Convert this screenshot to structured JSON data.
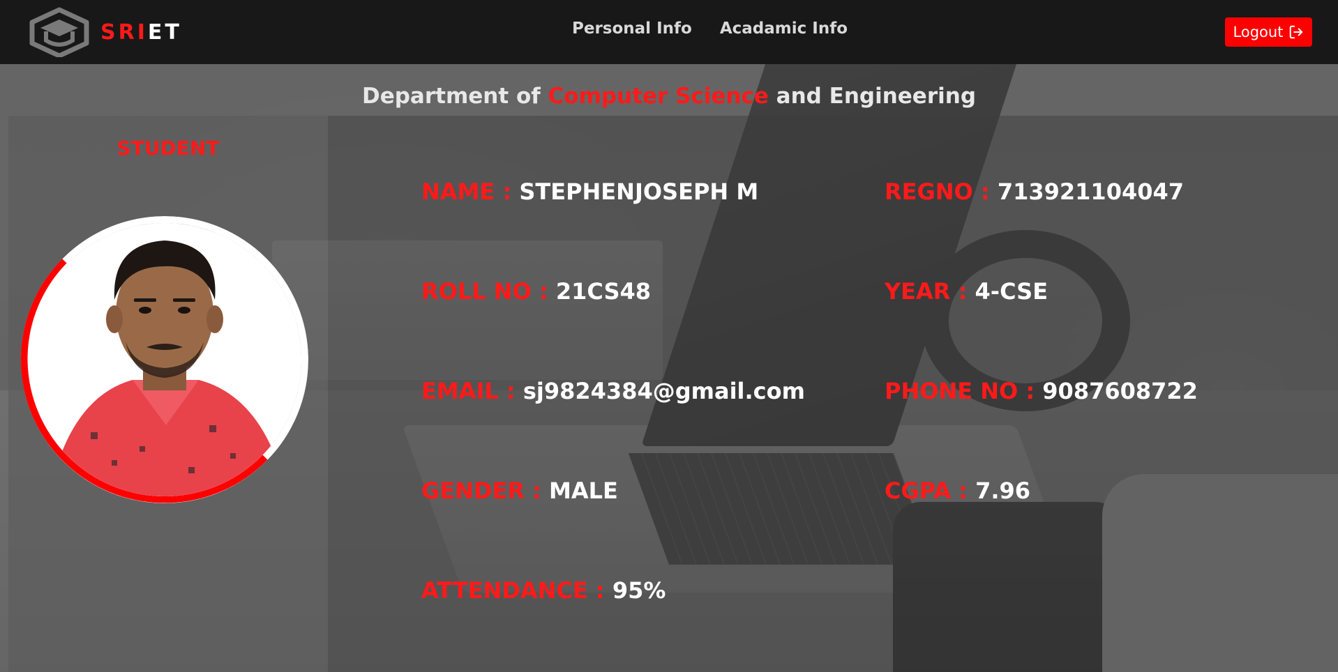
{
  "brand": {
    "part_red": "SRI",
    "part_white": "ET"
  },
  "nav": {
    "links": [
      {
        "label": "Personal Info"
      },
      {
        "label": "Acadamic Info"
      }
    ],
    "logout_label": "Logout"
  },
  "department": {
    "prefix": "Department of ",
    "highlight": "Computer Science",
    "suffix": " and Engineering"
  },
  "profile": {
    "role": "STUDENT",
    "photo": "student-photo"
  },
  "fields": {
    "name": {
      "label": "NAME : ",
      "value": "STEPHENJOSEPH M"
    },
    "regno": {
      "label": "REGNO : ",
      "value": "713921104047"
    },
    "rollno": {
      "label": "ROLL NO : ",
      "value": "21CS48"
    },
    "year": {
      "label": "YEAR : ",
      "value": "4-CSE"
    },
    "email": {
      "label": "EMAIL : ",
      "value": "sj9824384@gmail.com"
    },
    "phone": {
      "label": "PHONE NO : ",
      "value": "9087608722"
    },
    "gender": {
      "label": "GENDER : ",
      "value": "MALE"
    },
    "cgpa": {
      "label": "CGPA : ",
      "value": "7.96"
    },
    "attendance": {
      "label": "ATTENDANCE : ",
      "value": "95%"
    }
  },
  "colors": {
    "accent": "#ff1a1a",
    "navbar": "#181818",
    "logout_bg": "#ff0000"
  },
  "icons": [
    "graduation-cap-logo-icon",
    "logout-icon"
  ]
}
